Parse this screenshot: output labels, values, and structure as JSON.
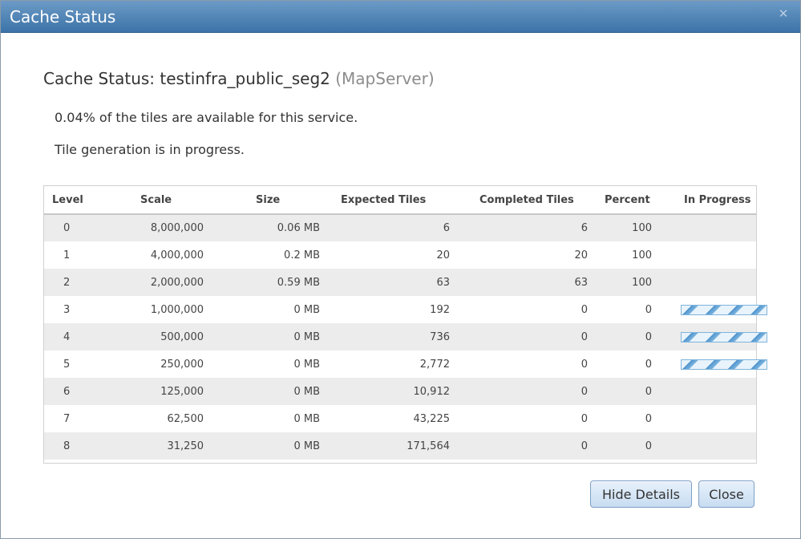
{
  "dialog": {
    "title": "Cache Status",
    "close_icon_glyph": "✕"
  },
  "heading": {
    "prefix": "Cache Status: testinfra_public_seg2",
    "service_type": "(MapServer)"
  },
  "messages": {
    "availability": "0.04% of the tiles are available for this service.",
    "generation": "Tile generation is in progress."
  },
  "table": {
    "columns": [
      "Level",
      "Scale",
      "Size",
      "Expected Tiles",
      "Completed Tiles",
      "Percent",
      "In Progress"
    ],
    "rows": [
      {
        "level": "0",
        "scale": "8,000,000",
        "size": "0.06 MB",
        "expected": "6",
        "completed": "6",
        "percent": "100",
        "in_progress": false
      },
      {
        "level": "1",
        "scale": "4,000,000",
        "size": "0.2 MB",
        "expected": "20",
        "completed": "20",
        "percent": "100",
        "in_progress": false
      },
      {
        "level": "2",
        "scale": "2,000,000",
        "size": "0.59 MB",
        "expected": "63",
        "completed": "63",
        "percent": "100",
        "in_progress": false
      },
      {
        "level": "3",
        "scale": "1,000,000",
        "size": "0 MB",
        "expected": "192",
        "completed": "0",
        "percent": "0",
        "in_progress": true
      },
      {
        "level": "4",
        "scale": "500,000",
        "size": "0 MB",
        "expected": "736",
        "completed": "0",
        "percent": "0",
        "in_progress": true
      },
      {
        "level": "5",
        "scale": "250,000",
        "size": "0 MB",
        "expected": "2,772",
        "completed": "0",
        "percent": "0",
        "in_progress": true
      },
      {
        "level": "6",
        "scale": "125,000",
        "size": "0 MB",
        "expected": "10,912",
        "completed": "0",
        "percent": "0",
        "in_progress": false
      },
      {
        "level": "7",
        "scale": "62,500",
        "size": "0 MB",
        "expected": "43,225",
        "completed": "0",
        "percent": "0",
        "in_progress": false
      },
      {
        "level": "8",
        "scale": "31,250",
        "size": "0 MB",
        "expected": "171,564",
        "completed": "0",
        "percent": "0",
        "in_progress": false
      }
    ]
  },
  "buttons": {
    "hide_details": "Hide Details",
    "close": "Close"
  },
  "colors": {
    "titlebar_top": "#6c9ac6",
    "titlebar_bottom": "#3c74a8",
    "progress_stripe": "#4f94cd",
    "row_alt": "#ececec"
  }
}
